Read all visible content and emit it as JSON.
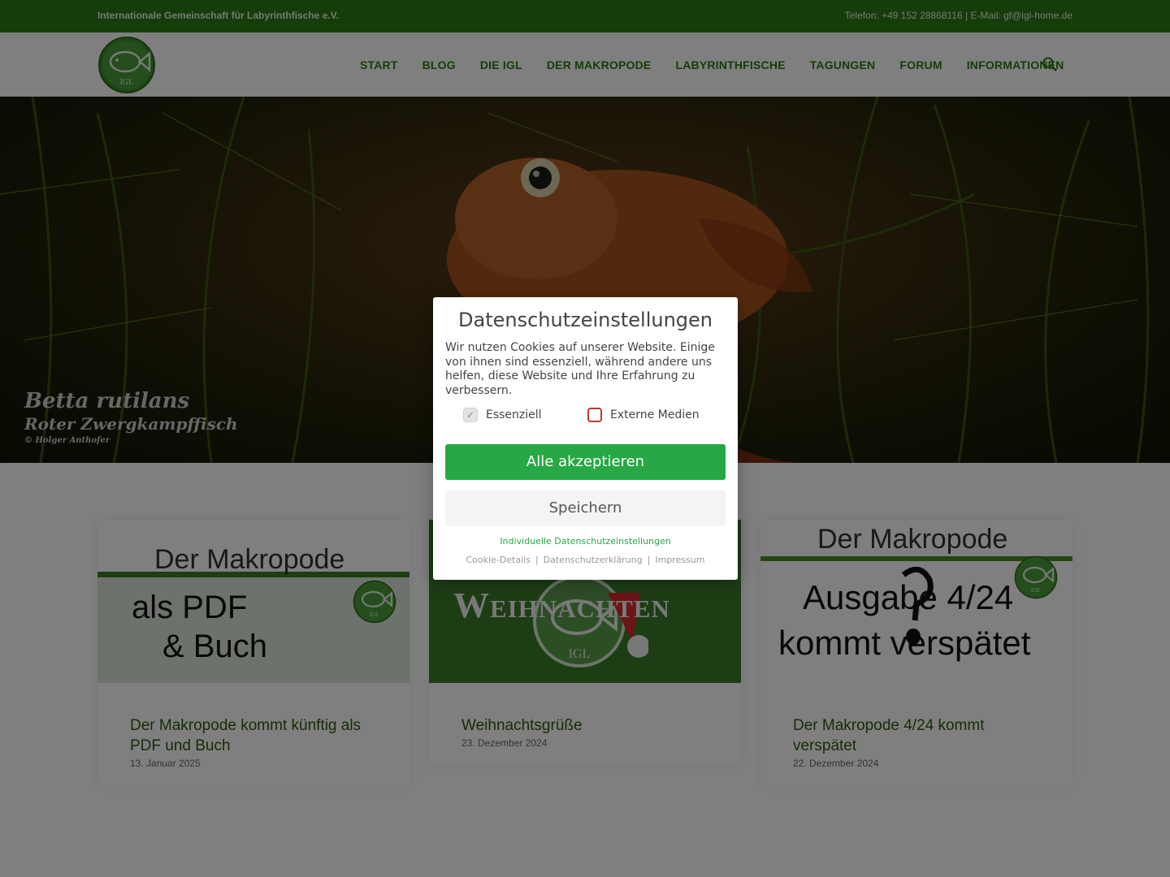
{
  "topbar": {
    "org": "Internationale Gemeinschaft für Labyrinthfische e.V.",
    "contact": "Telefon: +49 152 28868116 | E-Mail: gf@igl-home.de"
  },
  "header": {
    "logo_text": "IGL",
    "nav": [
      "START",
      "BLOG",
      "DIE IGL",
      "DER MAKROPODE",
      "LABYRINTHFISCHE",
      "TAGUNGEN",
      "FORUM",
      "INFORMATIONEN"
    ]
  },
  "hero": {
    "caption_species": "Betta rutilans",
    "caption_common": "Roter Zwergkampffisch",
    "caption_credit": "© Holger Anthofer"
  },
  "cards": [
    {
      "title": "Der Makropode kommt künftig als PDF und Buch",
      "date": "13. Januar 2025",
      "thumb": {
        "heading": "Der Makropode",
        "line1": "als PDF",
        "line2": "& Buch",
        "logo": "IGL"
      }
    },
    {
      "title": "Weihnachtsgrüße",
      "date": "23. Dezember 2024",
      "thumb": {
        "heading": "Weihnachten",
        "logo": "IGL"
      }
    },
    {
      "title": "Der Makropode 4/24 kommt verspätet",
      "date": "22. Dezember 2024",
      "thumb": {
        "heading": "Der Makropode",
        "line1": "Ausgabe 4/24",
        "line2": "kommt verspätet",
        "logo": "IGL"
      }
    }
  ],
  "cookie_modal": {
    "title": "Datenschutzeinstellungen",
    "text": "Wir nutzen Cookies auf unserer Website. Einige von ihnen sind essenziell, während andere uns helfen, diese Website und Ihre Erfahrung zu verbessern.",
    "checkbox_essential": "Essenziell",
    "checkbox_external": "Externe Medien",
    "accept_all": "Alle akzeptieren",
    "save": "Speichern",
    "individual": "Individuelle Datenschutzeinstellungen",
    "links": [
      "Cookie-Details",
      "Datenschutzerklärung",
      "Impressum"
    ]
  },
  "colors": {
    "brand_green": "#2b7a14",
    "accept_green": "#27a844",
    "title_green": "#2b5a10"
  }
}
